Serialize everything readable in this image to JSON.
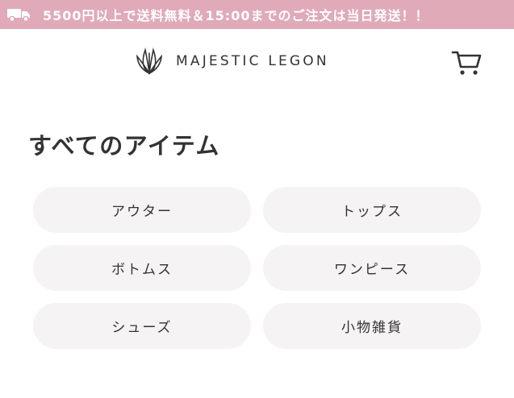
{
  "banner": {
    "icon": "truck-icon",
    "text": "5500円以上で送料無料＆15:00までのご注文は当日発送！！"
  },
  "header": {
    "logo_icon": "brand-leaf-logo-icon",
    "brand_name": "MAJESTIC LEGON",
    "cart_icon": "cart-icon"
  },
  "main": {
    "title": "すべてのアイテム",
    "categories": [
      {
        "label": "アウター"
      },
      {
        "label": "トップス"
      },
      {
        "label": "ボトムス"
      },
      {
        "label": "ワンピース"
      },
      {
        "label": "シューズ"
      },
      {
        "label": "小物雑貨"
      }
    ]
  },
  "colors": {
    "banner_bg": "#e0aab8",
    "button_bg": "#f5f3f3",
    "text": "#333333"
  }
}
